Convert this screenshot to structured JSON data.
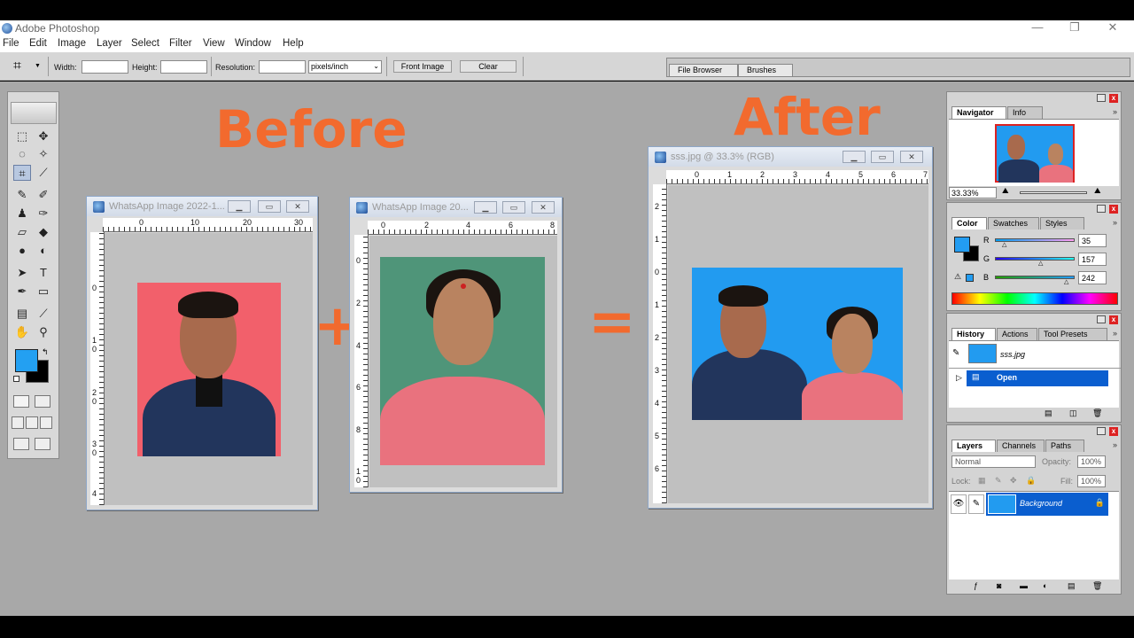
{
  "app": {
    "title": "Adobe Photoshop"
  },
  "menu": [
    "File",
    "Edit",
    "Image",
    "Layer",
    "Select",
    "Filter",
    "View",
    "Window",
    "Help"
  ],
  "options": {
    "width_label": "Width:",
    "height_label": "Height:",
    "resolution_label": "Resolution:",
    "units": "pixels/inch",
    "front_image": "Front Image",
    "clear": "Clear"
  },
  "well_tabs": [
    "File Browser",
    "Brushes"
  ],
  "labels": {
    "before": "Before",
    "after": "After",
    "plus": "+",
    "equals": "="
  },
  "docs": {
    "doc1": {
      "title": "WhatsApp Image 2022-1...",
      "ruler_h": [
        "0",
        "10",
        "20",
        "30"
      ],
      "ruler_v": [
        "0",
        "1 0",
        "2 0",
        "3 0",
        "4"
      ],
      "bg": "#f2606b"
    },
    "doc2": {
      "title": "WhatsApp Image 20...",
      "ruler_h": [
        "0",
        "2",
        "4",
        "6",
        "8"
      ],
      "ruler_v": [
        "0",
        "2",
        "4",
        "6",
        "8",
        "1 0"
      ],
      "bg": "#4f9579"
    },
    "doc3": {
      "title": "sss.jpg @ 33.3% (RGB)",
      "ruler_h": [
        "0",
        "1",
        "2",
        "3",
        "4",
        "5",
        "6",
        "7"
      ],
      "ruler_v": [
        "2",
        "1",
        "0",
        "1",
        "2",
        "3",
        "4",
        "5",
        "6"
      ],
      "bg": "#229bf0"
    }
  },
  "navigator": {
    "tabs": [
      "Navigator",
      "Info"
    ],
    "zoom": "33.33%"
  },
  "color": {
    "tabs": [
      "Color",
      "Swatches",
      "Styles"
    ],
    "r_label": "R",
    "g_label": "G",
    "b_label": "B",
    "r": "35",
    "g": "157",
    "b": "242",
    "foreground": "#239df2"
  },
  "history": {
    "tabs": [
      "History",
      "Actions",
      "Tool Presets"
    ],
    "snapshot": "sss.jpg",
    "state": "Open"
  },
  "layers": {
    "tabs": [
      "Layers",
      "Channels",
      "Paths"
    ],
    "blend_mode": "Normal",
    "opacity_label": "Opacity:",
    "opacity": "100%",
    "lock_label": "Lock:",
    "fill_label": "Fill:",
    "fill": "100%",
    "layer_name": "Background"
  }
}
